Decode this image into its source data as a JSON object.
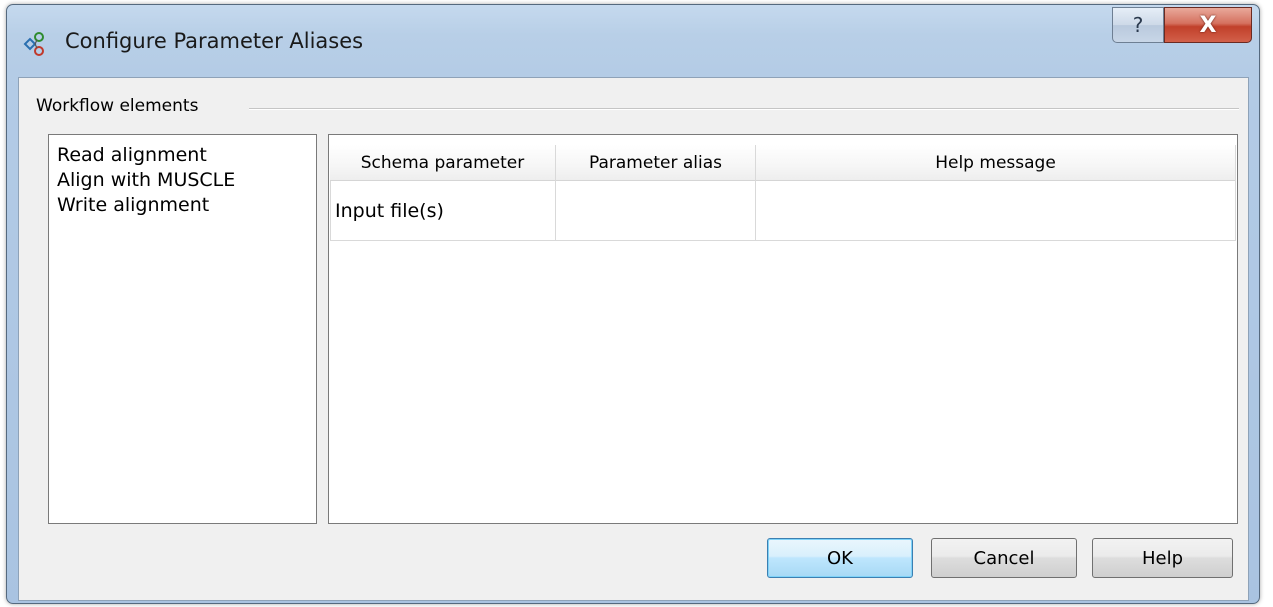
{
  "window": {
    "title": "Configure Parameter Aliases",
    "icon": "parameter-aliases-icon",
    "controls": {
      "help_icon": "question-mark-icon",
      "help_glyph": "?",
      "close_icon": "close-icon",
      "close_glyph": "X"
    }
  },
  "group": {
    "label": "Workflow elements"
  },
  "elements_list": [
    {
      "label": "Read alignment"
    },
    {
      "label": "Align with MUSCLE"
    },
    {
      "label": "Write alignment"
    }
  ],
  "table": {
    "columns": [
      "Schema parameter",
      "Parameter alias",
      "Help message"
    ],
    "rows": [
      {
        "schema_parameter": "Input file(s)",
        "parameter_alias": "",
        "help_message": ""
      }
    ]
  },
  "buttons": {
    "ok": "OK",
    "cancel": "Cancel",
    "help": "Help"
  },
  "colors": {
    "title_bar": "#b8cfe7",
    "close_button": "#c1402a",
    "default_button_border": "#3c7fb1"
  }
}
